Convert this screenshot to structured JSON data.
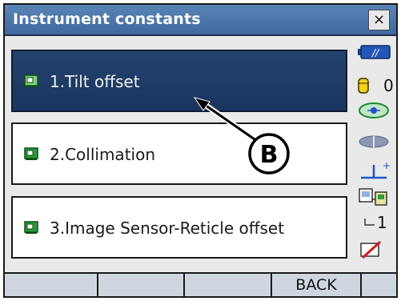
{
  "window": {
    "title": "Instrument constants",
    "close_label": "×"
  },
  "menu": {
    "items": [
      {
        "label": "1.Tilt offset",
        "selected": true
      },
      {
        "label": "2.Collimation",
        "selected": false
      },
      {
        "label": "3.Image Sensor-Reticle offset",
        "selected": false
      }
    ]
  },
  "status": {
    "battery_icon": "battery-icon",
    "battery_level": 0.5,
    "target_constant": "0",
    "target_icon": "prism-target-icon",
    "laser_icon": "laser-pointer-icon",
    "tilt_icon": "tilt-compensation-icon",
    "comm_icon": "communication-icon",
    "input_mode": "1",
    "input_icon": "input-mode-icon"
  },
  "softkeys": [
    "",
    "",
    "",
    "BACK",
    ""
  ],
  "callout": {
    "label": "B"
  },
  "colors": {
    "titlebar": "#4a74aa",
    "selected_row": "#1f3b66",
    "icon_green": "#2a9a3a"
  }
}
